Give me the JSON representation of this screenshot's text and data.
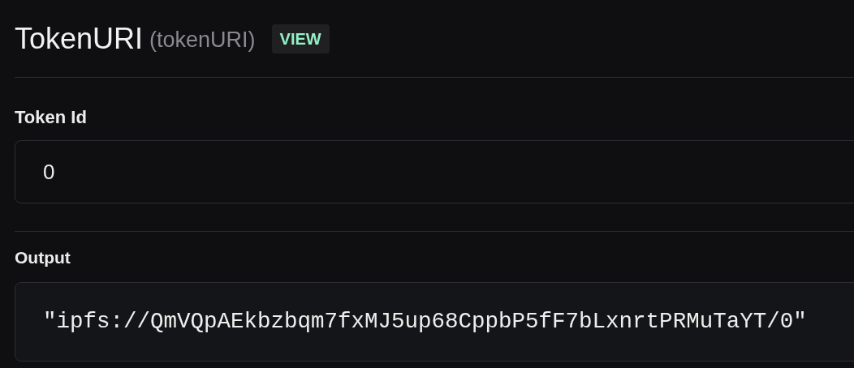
{
  "header": {
    "title": "TokenURI",
    "function_name": "(tokenURI)",
    "badge": "VIEW"
  },
  "input": {
    "label": "Token Id",
    "value": "0"
  },
  "output": {
    "label": "Output",
    "value": "\"ipfs://QmVQpAEkbzbqm7fxMJ5up68CppbP5fF7bLxnrtPRMuTaYT/0\""
  }
}
